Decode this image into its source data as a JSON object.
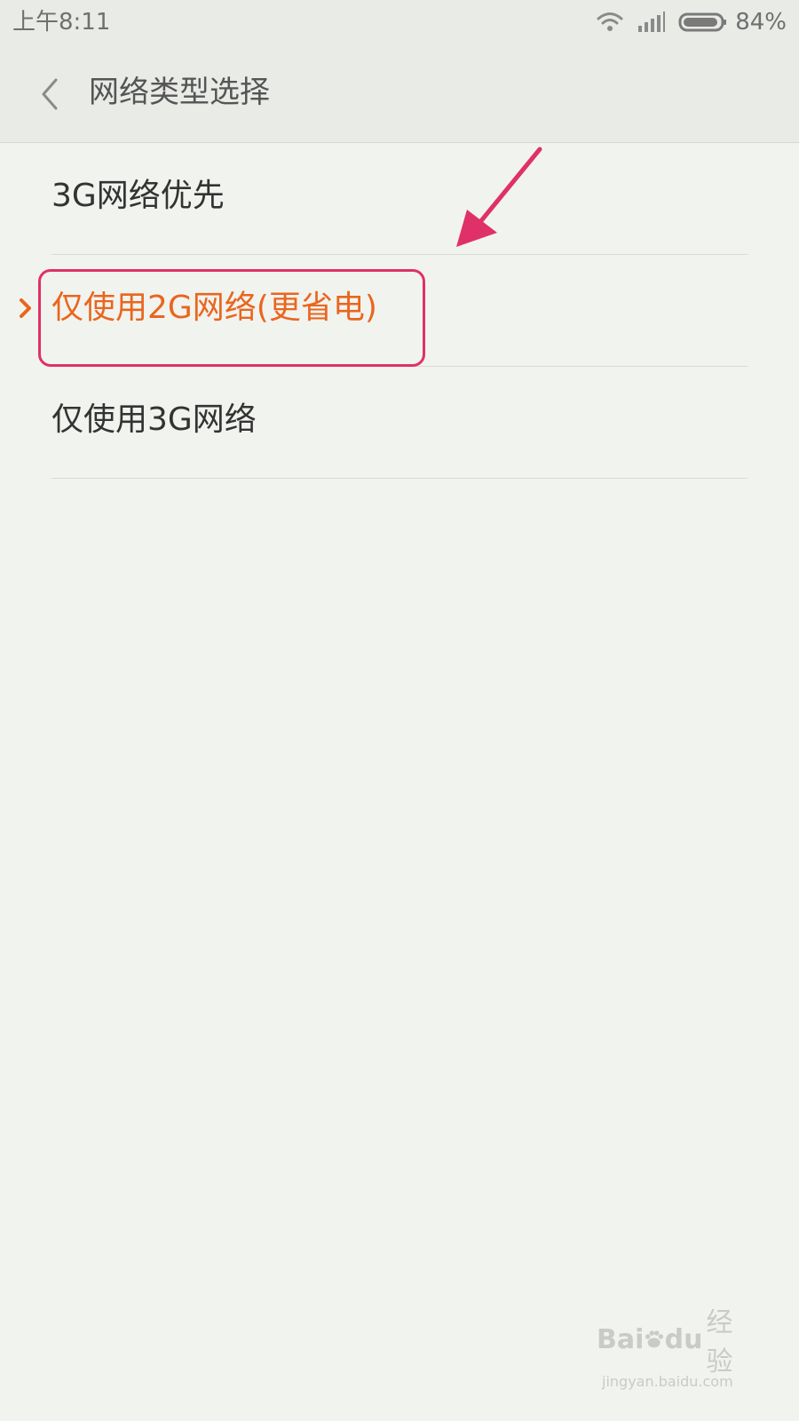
{
  "status_bar": {
    "time": "上午8:11",
    "battery": "84%",
    "icons": [
      "wifi-icon",
      "signal-icon",
      "battery-icon"
    ]
  },
  "header": {
    "title": "网络类型选择",
    "back_icon": "chevron-left-icon"
  },
  "options": [
    {
      "label": "3G网络优先",
      "selected": false
    },
    {
      "label": "仅使用2G网络(更省电)",
      "selected": true
    },
    {
      "label": "仅使用3G网络",
      "selected": false
    }
  ],
  "colors": {
    "background": "#f1f3ef",
    "header_bg": "#e9ebe7",
    "text": "#333333",
    "selected_text": "#e9661d",
    "annotation": "#e0306a"
  },
  "watermark": {
    "brand": "Bai",
    "brand_suffix": "du",
    "product": "经验",
    "url": "jingyan.baidu.com"
  }
}
